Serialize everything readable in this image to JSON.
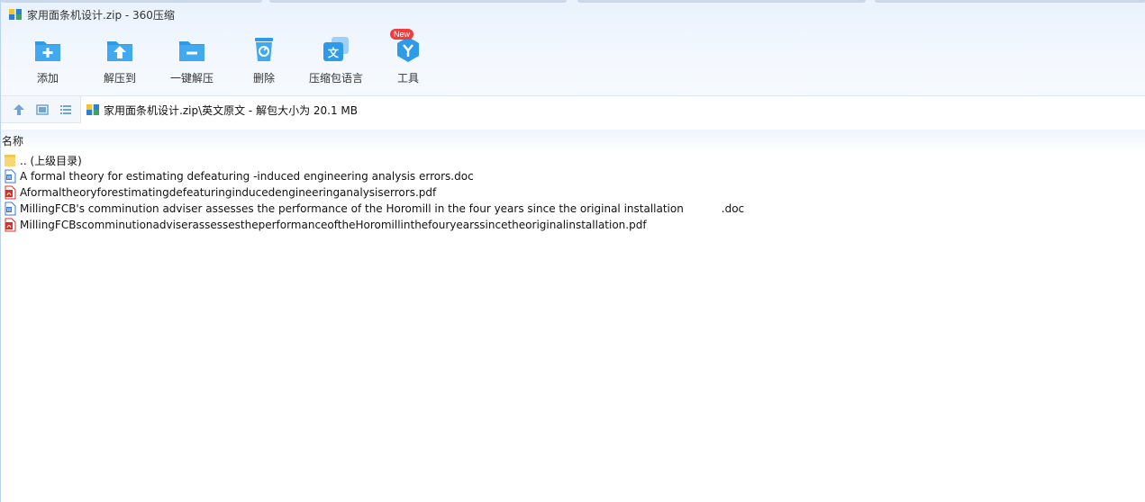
{
  "window": {
    "title": "家用面条机设计.zip - 360压缩"
  },
  "toolbar": {
    "items": [
      {
        "label": "添加",
        "icon": "add-icon"
      },
      {
        "label": "解压到",
        "icon": "extract-to-icon"
      },
      {
        "label": "一键解压",
        "icon": "quick-extract-icon"
      },
      {
        "label": "删除",
        "icon": "delete-icon"
      },
      {
        "label": "压缩包语言",
        "icon": "language-icon"
      },
      {
        "label": "工具",
        "icon": "tools-icon",
        "badge": "New"
      }
    ]
  },
  "address": {
    "path": "家用面条机设计.zip\\英文原文 - 解包大小为 20.1 MB"
  },
  "list": {
    "column_name": "名称",
    "rows": [
      {
        "name": ".. (上级目录)",
        "type": "folder"
      },
      {
        "name": "A formal theory for estimating defeaturing -induced  engineering analysis errors.doc",
        "type": "doc"
      },
      {
        "name": "Aformaltheoryforestimatingdefeaturinginducedengineeringanalysiserrors.pdf",
        "type": "pdf"
      },
      {
        "name": "MillingFCB's comminution adviser assesses the performance of the Horomill in the four years since the original installation           .doc",
        "type": "doc"
      },
      {
        "name": "MillingFCBscomminutionadviserassessestheperformanceoftheHoromillinthefouryearssincetheoriginalinstallation.pdf",
        "type": "pdf"
      }
    ]
  },
  "colors": {
    "accent_blue": "#2d9be8",
    "badge_red": "#f23b3b",
    "folder_yellow": "#f7d774",
    "pdf_red": "#d9302c",
    "doc_blue": "#3c78c3"
  }
}
